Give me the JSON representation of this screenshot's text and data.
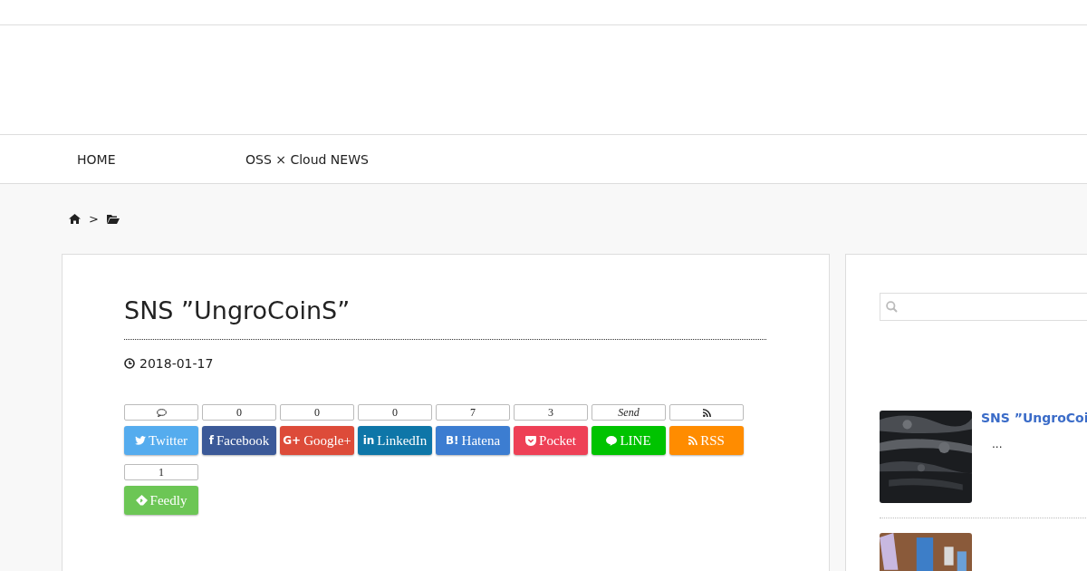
{
  "nav": [
    {
      "label": "HOME"
    },
    {
      "label": "OSS × Cloud NEWS"
    }
  ],
  "breadcrumb": {
    "separator": ">"
  },
  "post": {
    "title": "SNS ”UngroCoinS”",
    "date": "2018-01-17"
  },
  "share": [
    {
      "kind": "twitter",
      "label": "Twitter",
      "color": "#55acee",
      "count": {
        "kind": "comment"
      }
    },
    {
      "kind": "facebook",
      "label": "Facebook",
      "icon_text": "f",
      "color": "#3b5998",
      "count": {
        "kind": "text",
        "text": "0"
      }
    },
    {
      "kind": "google",
      "label": "Google+",
      "icon_text": "G+",
      "color": "#dd4b39",
      "count": {
        "kind": "text",
        "text": "0"
      }
    },
    {
      "kind": "linkedin",
      "label": "LinkedIn",
      "icon_text": "in",
      "color": "#0e76a8",
      "count": {
        "kind": "text",
        "text": "0"
      }
    },
    {
      "kind": "hatena",
      "label": "Hatena",
      "icon_text": "B!",
      "color": "#3c7dd1",
      "count": {
        "kind": "text",
        "text": "7"
      }
    },
    {
      "kind": "pocket",
      "label": "Pocket",
      "color": "#ee4056",
      "count": {
        "kind": "text",
        "text": "3"
      }
    },
    {
      "kind": "line",
      "label": "LINE",
      "color": "#00c300",
      "count": {
        "kind": "send",
        "text": "Send"
      }
    },
    {
      "kind": "rss",
      "label": "RSS",
      "color": "#ff8c00",
      "count": {
        "kind": "rss"
      }
    },
    {
      "kind": "feedly",
      "label": "Feedly",
      "color": "#6cc655",
      "count": {
        "kind": "text",
        "text": "1"
      }
    }
  ],
  "sidebar": {
    "posts": [
      {
        "kind": "picture",
        "title": "SNS ”UngroCoi",
        "excerpt": "..."
      },
      {
        "kind": "picture"
      }
    ]
  }
}
